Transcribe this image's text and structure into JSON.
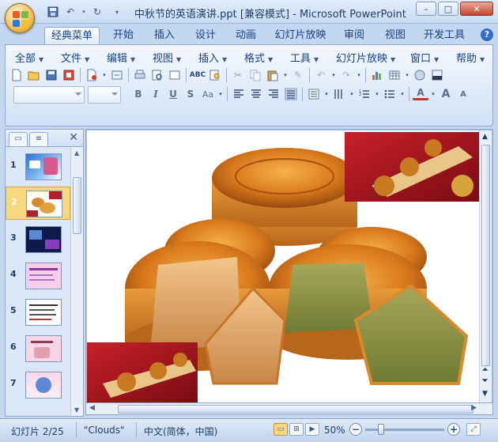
{
  "window": {
    "title": "中秋节的英语演讲.ppt [兼容模式] - Microsoft PowerPoint",
    "minimize_glyph": "–",
    "maximize_glyph": "□",
    "close_glyph": "✕"
  },
  "ribbon_tabs": [
    {
      "label": "经典菜单",
      "active": true
    },
    {
      "label": "开始"
    },
    {
      "label": "插入"
    },
    {
      "label": "设计"
    },
    {
      "label": "动画"
    },
    {
      "label": "幻灯片放映"
    },
    {
      "label": "审阅"
    },
    {
      "label": "视图"
    },
    {
      "label": "开发工具"
    }
  ],
  "help_glyph": "?",
  "classic_menu": [
    {
      "label": "全部"
    },
    {
      "label": "文件"
    },
    {
      "label": "编辑"
    },
    {
      "label": "视图"
    },
    {
      "label": "插入"
    },
    {
      "label": "格式"
    },
    {
      "label": "工具"
    },
    {
      "label": "幻灯片放映"
    },
    {
      "label": "窗口"
    },
    {
      "label": "帮助"
    }
  ],
  "format_buttons": {
    "bold": "B",
    "italic": "I",
    "underline": "U",
    "strike": "S",
    "case": "Aa"
  },
  "font_size_buttons": {
    "font_color": "A",
    "grow": "A",
    "shrink": "A"
  },
  "left_pane": {
    "close_glyph": "✕",
    "slides": [
      {
        "num": "1"
      },
      {
        "num": "2",
        "selected": true
      },
      {
        "num": "3"
      },
      {
        "num": "4"
      },
      {
        "num": "5"
      },
      {
        "num": "6"
      },
      {
        "num": "7"
      }
    ]
  },
  "status_bar": {
    "slide_info": "幻灯片 2/25",
    "theme": "\"Clouds\"",
    "language": "中文(简体，中国)",
    "zoom": "50%",
    "zoom_minus": "−",
    "zoom_plus": "+"
  },
  "colors": {
    "accent": "#15428b",
    "ribbon_bg": "#dbe8f8",
    "selected_thumb": "#f9d77e"
  }
}
